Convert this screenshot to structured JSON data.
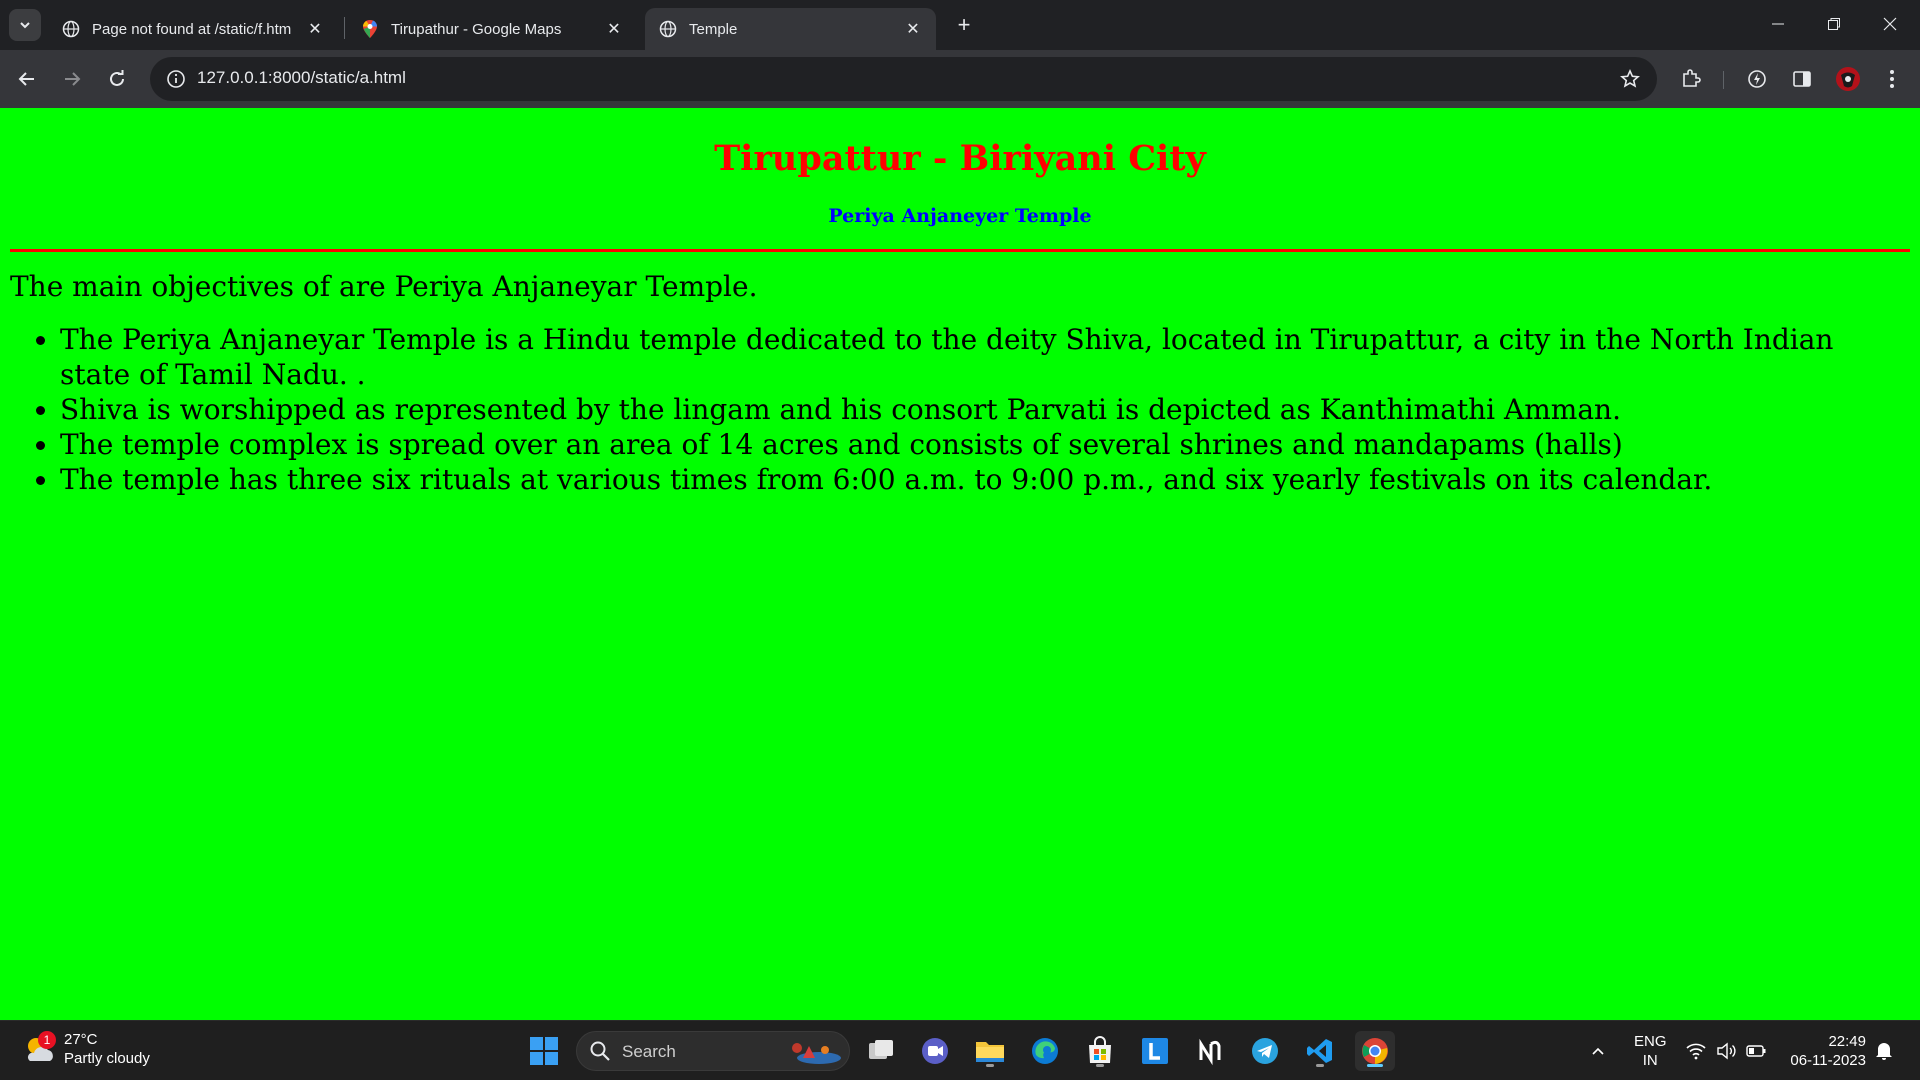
{
  "browser": {
    "tabs": [
      {
        "title": "Page not found at /static/f.htm",
        "icon": "globe-icon"
      },
      {
        "title": "Tirupathur - Google Maps",
        "icon": "maps-pin-icon"
      },
      {
        "title": "Temple",
        "icon": "globe-icon",
        "active": true
      }
    ],
    "url": "127.0.0.1:8000/static/a.html"
  },
  "page": {
    "title": "Tirupattur - Biriyani City",
    "subtitle": "Periya Anjaneyer Temple",
    "intro": "The main objectives of are Periya Anjaneyar Temple.",
    "items": [
      "The Periya Anjaneyar Temple is a Hindu temple dedicated to the deity Shiva, located in Tirupattur, a city in the North Indian state of Tamil Nadu. .",
      "Shiva is worshipped as represented by the lingam and his consort Parvati is depicted as Kanthimathi Amman.",
      "The temple complex is spread over an area of 14 acres and consists of several shrines and mandapams (halls)",
      "The temple has three six rituals at various times from 6:00 a.m. to 9:00 p.m., and six yearly festivals on its calendar."
    ],
    "colors": {
      "background": "#00ff00",
      "title": "#ff0000",
      "subtitle": "#0000ff",
      "rule": "#ff0000"
    }
  },
  "taskbar": {
    "weather": {
      "temp": "27°C",
      "condition": "Partly cloudy",
      "badge": "1"
    },
    "search_label": "Search",
    "apps": [
      "windows-start-icon",
      "task-view-icon",
      "meet-icon",
      "file-explorer-icon",
      "edge-icon",
      "store-icon",
      "l-app-icon",
      "notion-icon",
      "telegram-icon",
      "vscode-icon",
      "chrome-icon"
    ],
    "language": {
      "line1": "ENG",
      "line2": "IN"
    },
    "time": "22:49",
    "date": "06-11-2023"
  }
}
